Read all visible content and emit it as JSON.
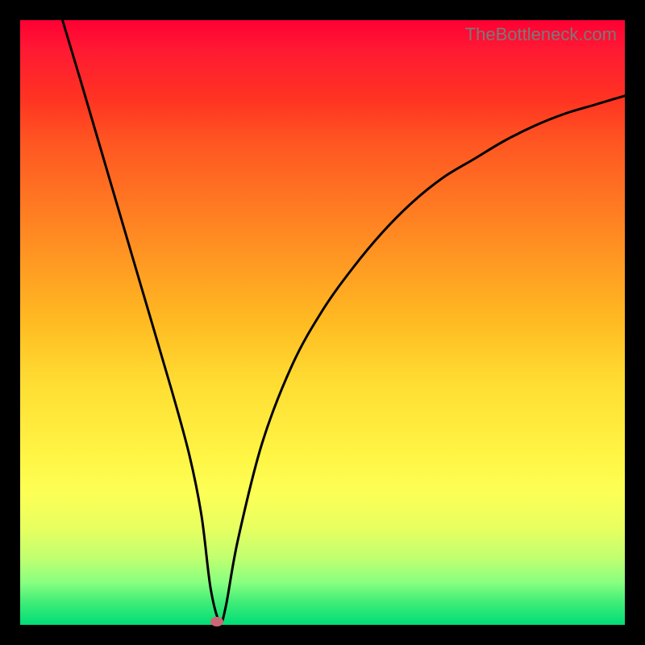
{
  "watermark": "TheBottleneck.com",
  "chart_data": {
    "type": "line",
    "title": "",
    "xlabel": "",
    "ylabel": "",
    "xlim": [
      0,
      100
    ],
    "ylim": [
      0,
      100
    ],
    "gradient_stops": [
      {
        "pos": 0,
        "color": "#ff0033"
      },
      {
        "pos": 50,
        "color": "#ffbb22"
      },
      {
        "pos": 78,
        "color": "#fdff55"
      },
      {
        "pos": 100,
        "color": "#00dd77"
      }
    ],
    "series": [
      {
        "name": "bottleneck-curve",
        "x": [
          7,
          10,
          15,
          20,
          25,
          28,
          30,
          31.5,
          33,
          34,
          36,
          40,
          45,
          50,
          55,
          60,
          65,
          70,
          75,
          80,
          85,
          90,
          95,
          100
        ],
        "y": [
          100,
          90,
          73,
          56,
          39,
          28,
          18,
          6,
          0.5,
          3,
          14,
          30,
          43,
          52,
          59,
          65,
          70,
          74,
          77,
          80,
          82.5,
          84.5,
          86,
          87.5
        ]
      }
    ],
    "marker": {
      "x": 32.5,
      "y": 0.5,
      "color": "#cc6677"
    }
  }
}
